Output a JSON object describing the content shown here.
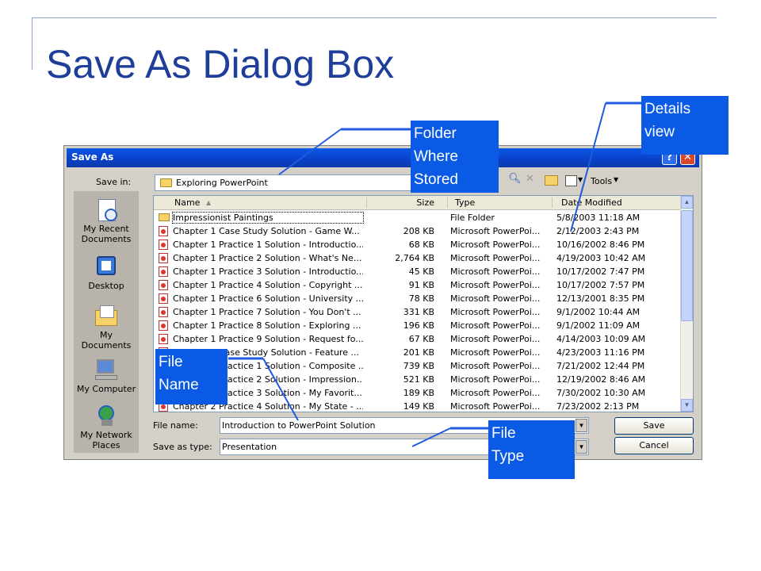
{
  "slide": {
    "title": "Save As Dialog Box"
  },
  "dialog": {
    "title": "Save As",
    "help_glyph": "?",
    "close_glyph": "✕",
    "save_in_label": "Save in:",
    "save_in_value": "Exploring PowerPoint",
    "tools_label": "Tools",
    "places": [
      {
        "label": "My Recent Documents",
        "icon": "recent-documents-icon"
      },
      {
        "label": "Desktop",
        "icon": "desktop-icon"
      },
      {
        "label": "My Documents",
        "icon": "my-documents-icon"
      },
      {
        "label": "My Computer",
        "icon": "my-computer-icon"
      },
      {
        "label": "My Network Places",
        "icon": "network-places-icon"
      }
    ],
    "columns": {
      "name": "Name",
      "size": "Size",
      "type": "Type",
      "date": "Date Modified"
    },
    "files": [
      {
        "name": "Impressionist Paintings",
        "size": "",
        "type": "File Folder",
        "date": "5/8/2003 11:18 AM"
      },
      {
        "name": "Chapter 1 Case Study Solution - Game W...",
        "size": "208 KB",
        "type": "Microsoft PowerPoi...",
        "date": "2/12/2003 2:43 PM"
      },
      {
        "name": "Chapter 1 Practice 1 Solution - Introductio...",
        "size": "68 KB",
        "type": "Microsoft PowerPoi...",
        "date": "10/16/2002 8:46 PM"
      },
      {
        "name": "Chapter 1 Practice 2 Solution - What's Ne...",
        "size": "2,764 KB",
        "type": "Microsoft PowerPoi...",
        "date": "4/19/2003 10:42 AM"
      },
      {
        "name": "Chapter 1 Practice 3 Solution - Introductio...",
        "size": "45 KB",
        "type": "Microsoft PowerPoi...",
        "date": "10/17/2002 7:47 PM"
      },
      {
        "name": "Chapter 1 Practice 4 Solution - Copyright ...",
        "size": "91 KB",
        "type": "Microsoft PowerPoi...",
        "date": "10/17/2002 7:57 PM"
      },
      {
        "name": "Chapter 1 Practice 6 Solution - University ...",
        "size": "78 KB",
        "type": "Microsoft PowerPoi...",
        "date": "12/13/2001 8:35 PM"
      },
      {
        "name": "Chapter 1 Practice 7 Solution - You Don't ...",
        "size": "331 KB",
        "type": "Microsoft PowerPoi...",
        "date": "9/1/2002 10:44 AM"
      },
      {
        "name": "Chapter 1 Practice 8 Solution - Exploring ...",
        "size": "196 KB",
        "type": "Microsoft PowerPoi...",
        "date": "9/1/2002 11:09 AM"
      },
      {
        "name": "Chapter 1 Practice 9 Solution - Request fo...",
        "size": "67 KB",
        "type": "Microsoft PowerPoi...",
        "date": "4/14/2003 10:09 AM"
      },
      {
        "name": "Chapter 2 Case Study Solution - Feature ...",
        "size": "201 KB",
        "type": "Microsoft PowerPoi...",
        "date": "4/23/2003 11:16 PM"
      },
      {
        "name": "Chapter 2 Practice 1 Solution - Composite ...",
        "size": "739 KB",
        "type": "Microsoft PowerPoi...",
        "date": "7/21/2002 12:44 PM"
      },
      {
        "name": "Chapter 2 Practice 2 Solution - Impression...",
        "size": "521 KB",
        "type": "Microsoft PowerPoi...",
        "date": "12/19/2002 8:46 AM"
      },
      {
        "name": "Chapter 2 Practice 3 Solution - My Favorit...",
        "size": "189 KB",
        "type": "Microsoft PowerPoi...",
        "date": "7/30/2002 10:30 AM"
      },
      {
        "name": "Chapter 2 Practice 4 Solution - My State - ...",
        "size": "149 KB",
        "type": "Microsoft PowerPoi...",
        "date": "7/23/2002 2:13 PM"
      }
    ],
    "file_name_label": "File name:",
    "file_name_value": "Introduction to PowerPoint Solution",
    "save_as_type_label": "Save as type:",
    "save_as_type_value": "Presentation",
    "save_button": "Save",
    "cancel_button": "Cancel"
  },
  "callouts": {
    "folder": [
      "Folder",
      "Where",
      "Stored"
    ],
    "details": [
      "Details",
      "view"
    ],
    "file_name": [
      "File",
      "Name"
    ],
    "file_type": [
      "File",
      "Type"
    ]
  },
  "colors": {
    "callout": "#0a5ae6",
    "title": "#1f3e9a",
    "titlebar": "#0a58e6"
  }
}
